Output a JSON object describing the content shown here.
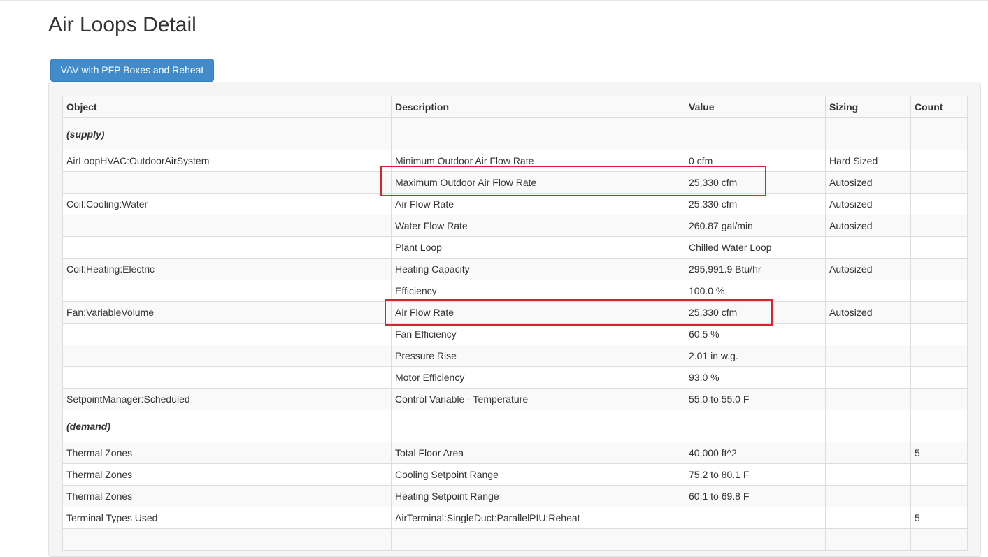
{
  "page": {
    "title": "Air Loops Detail"
  },
  "tabs": [
    {
      "label": "VAV with PFP Boxes and Reheat",
      "active": true
    }
  ],
  "table": {
    "columns": [
      "Object",
      "Description",
      "Value",
      "Sizing",
      "Count"
    ],
    "rows": [
      {
        "section": "(supply)"
      },
      {
        "object": "AirLoopHVAC:OutdoorAirSystem",
        "description": "Minimum Outdoor Air Flow Rate",
        "value": "0 cfm",
        "sizing": "Hard Sized",
        "count": ""
      },
      {
        "object": "",
        "description": "Maximum Outdoor Air Flow Rate",
        "value": "25,330 cfm",
        "sizing": "Autosized",
        "count": ""
      },
      {
        "object": "Coil:Cooling:Water",
        "description": "Air Flow Rate",
        "value": "25,330 cfm",
        "sizing": "Autosized",
        "count": ""
      },
      {
        "object": "",
        "description": "Water Flow Rate",
        "value": "260.87 gal/min",
        "sizing": "Autosized",
        "count": ""
      },
      {
        "object": "",
        "description": "Plant Loop",
        "value": "Chilled Water Loop",
        "sizing": "",
        "count": ""
      },
      {
        "object": "Coil:Heating:Electric",
        "description": "Heating Capacity",
        "value": "295,991.9 Btu/hr",
        "sizing": "Autosized",
        "count": ""
      },
      {
        "object": "",
        "description": "Efficiency",
        "value": "100.0 %",
        "sizing": "",
        "count": ""
      },
      {
        "object": "Fan:VariableVolume",
        "description": "Air Flow Rate",
        "value": "25,330 cfm",
        "sizing": "Autosized",
        "count": ""
      },
      {
        "object": "",
        "description": "Fan Efficiency",
        "value": "60.5 %",
        "sizing": "",
        "count": ""
      },
      {
        "object": "",
        "description": "Pressure Rise",
        "value": "2.01 in w.g.",
        "sizing": "",
        "count": ""
      },
      {
        "object": "",
        "description": "Motor Efficiency",
        "value": "93.0 %",
        "sizing": "",
        "count": ""
      },
      {
        "object": "SetpointManager:Scheduled",
        "description": "Control Variable - Temperature",
        "value": "55.0 to 55.0 F",
        "sizing": "",
        "count": ""
      },
      {
        "section": "(demand)"
      },
      {
        "object": "Thermal Zones",
        "description": "Total Floor Area",
        "value": "40,000 ft^2",
        "sizing": "",
        "count": "5"
      },
      {
        "object": "Thermal Zones",
        "description": "Cooling Setpoint Range",
        "value": "75.2 to 80.1 F",
        "sizing": "",
        "count": ""
      },
      {
        "object": "Thermal Zones",
        "description": "Heating Setpoint Range",
        "value": "60.1 to 69.8 F",
        "sizing": "",
        "count": ""
      },
      {
        "object": "Terminal Types Used",
        "description": "AirTerminal:SingleDuct:ParallelPIU:Reheat",
        "value": "",
        "sizing": "",
        "count": "5"
      },
      {
        "object": "",
        "description": "",
        "value": "",
        "sizing": "",
        "count": ""
      }
    ]
  },
  "annotations": {
    "highlight_color": "#d9232d",
    "highlighted_rows": [
      "Maximum Outdoor Air Flow Rate",
      "Fan:VariableVolume Air Flow Rate"
    ]
  }
}
